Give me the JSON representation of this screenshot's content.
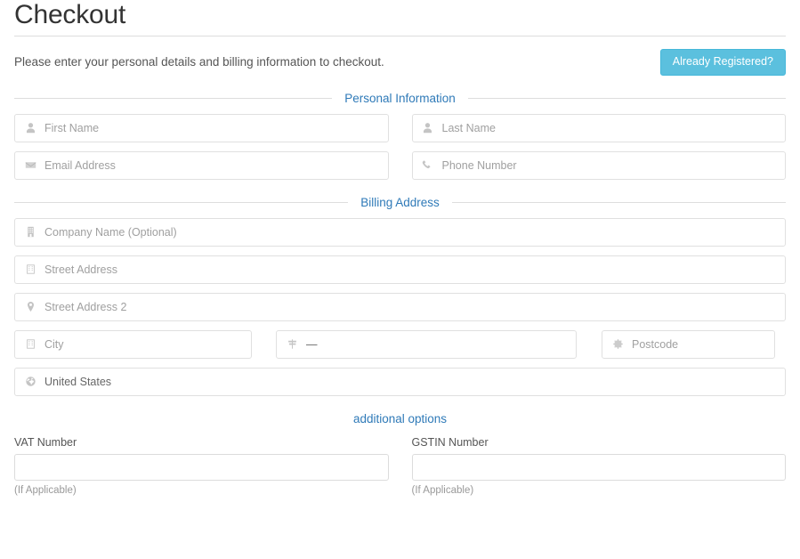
{
  "header": {
    "title": "Checkout",
    "intro": "Please enter your personal details and billing information to checkout.",
    "registered_button": "Already Registered?"
  },
  "sections": {
    "personal": "Personal Information",
    "billing": "Billing Address",
    "additional": "additional options"
  },
  "personal_fields": {
    "first_name": "First Name",
    "last_name": "Last Name",
    "email": "Email Address",
    "phone": "Phone Number"
  },
  "billing_fields": {
    "company": "Company Name (Optional)",
    "street1": "Street Address",
    "street2": "Street Address 2",
    "city": "City",
    "state": "—",
    "postcode": "Postcode",
    "country": "United States"
  },
  "additional_fields": {
    "vat_label": "VAT Number",
    "vat_value": "",
    "vat_help": "(If Applicable)",
    "gstin_label": "GSTIN Number",
    "gstin_value": "",
    "gstin_help": "(If Applicable)"
  },
  "colors": {
    "accent_button": "#5bc0de",
    "legend_blue": "#2f7ab8",
    "border": "#e0e0e0",
    "placeholder": "#a0a0a0"
  }
}
